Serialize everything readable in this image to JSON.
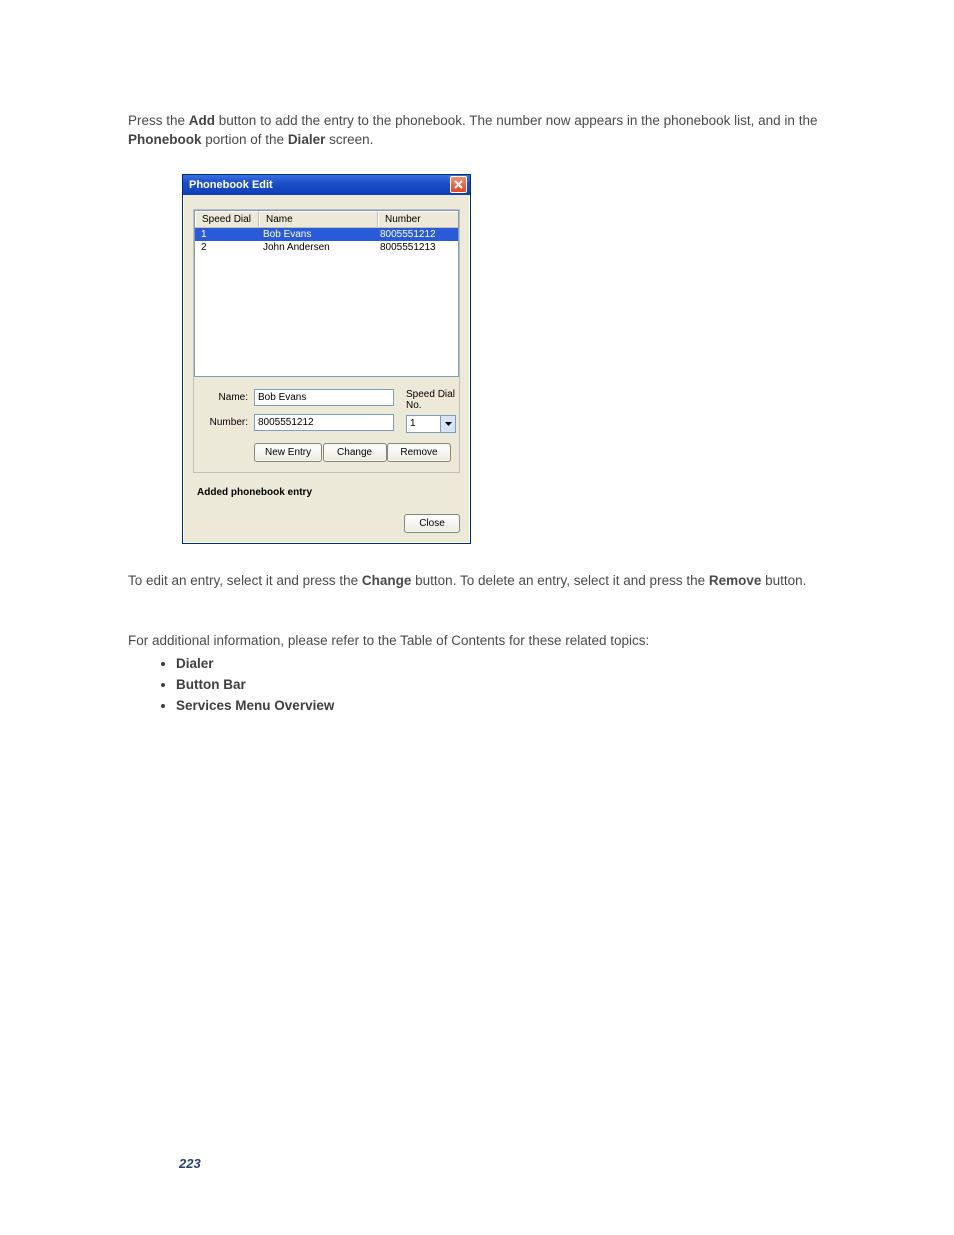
{
  "intro": {
    "t0": "Press the ",
    "b0": "Add",
    "t1": " button to add the entry to the phonebook. The number now appears in the phonebook list, and in the ",
    "b1": "Phonebook",
    "t2": " portion of the ",
    "b2": "Dialer",
    "t3": " screen."
  },
  "dialog": {
    "title": "Phonebook Edit",
    "headers": {
      "sd": "Speed Dial",
      "name": "Name",
      "number": "Number"
    },
    "rows": [
      {
        "sd": "1",
        "name": "Bob Evans",
        "number": "8005551212",
        "selected": true
      },
      {
        "sd": "2",
        "name": "John Andersen",
        "number": "8005551213",
        "selected": false
      }
    ],
    "form": {
      "name_label": "Name:",
      "name_value": "Bob Evans",
      "number_label": "Number:",
      "number_value": "8005551212",
      "sd_label": "Speed Dial No.",
      "sd_value": "1"
    },
    "buttons": {
      "new_entry": "New Entry",
      "change": "Change",
      "remove": "Remove",
      "close": "Close"
    },
    "status": "Added phonebook entry"
  },
  "after": {
    "t0": "To edit an entry, select it and press the ",
    "b0": "Change",
    "t1": " button. To delete an entry, select it and press the ",
    "b1": "Remove",
    "t2": " button."
  },
  "addinfo": "For additional information, please refer to the Table of Contents for these related topics:",
  "topics": [
    "Dialer",
    "Button Bar",
    "Services Menu Overview"
  ],
  "page_number": "223"
}
